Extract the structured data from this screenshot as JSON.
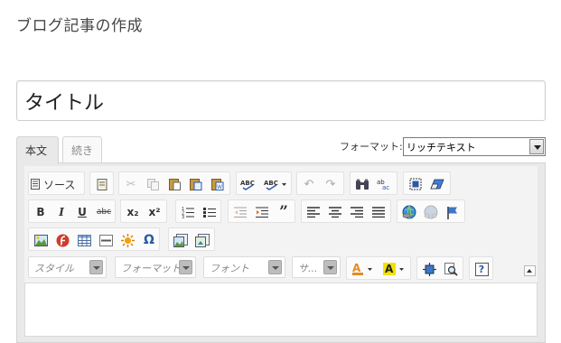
{
  "page": {
    "title": "ブログ記事の作成"
  },
  "post": {
    "title_value": "タイトル"
  },
  "tabs": [
    {
      "label": "本文",
      "active": true
    },
    {
      "label": "続き",
      "active": false
    }
  ],
  "format": {
    "label": "フォーマット:",
    "selected": "リッチテキスト"
  },
  "toolbar": {
    "source_label": "ソース",
    "bold": "B",
    "italic": "I",
    "underline": "U",
    "strike": "abc",
    "subscript": "x₂",
    "superscript": "x²",
    "omega": "Ω",
    "help": "?",
    "style_combo": "スタイル",
    "format_combo": "フォーマット",
    "font_combo": "フォント",
    "size_combo": "サ..."
  },
  "colors": {
    "accent_blue": "#2a5aa8",
    "highlight_yellow": "#f2e200",
    "text_color_orange": "#e58b1f"
  }
}
